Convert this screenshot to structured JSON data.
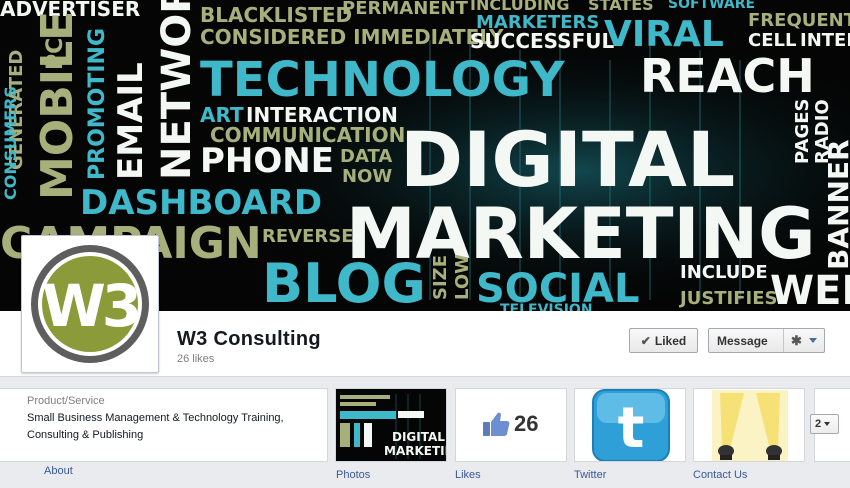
{
  "cover": {
    "words": [
      "ADVERTISER",
      "BLACKLISTED",
      "PERMANENT",
      "INCLUDING",
      "STATES",
      "SOFTWARE",
      "MARKETERS",
      "VIRAL",
      "FREQUENT",
      "CONSIDERED IMMEDIATELY",
      "SUCCESSFUL",
      "CELL",
      "INTER",
      "MOBILE",
      "PC",
      "GENERATED",
      "PROMOTING",
      "EMAIL",
      "NETWORK",
      "TECHNOLOGY",
      "REACH",
      "ART",
      "INTERACTION",
      "COMMUNICATION",
      "PHONE",
      "DATA",
      "NOW",
      "DIGITAL",
      "MARKETING",
      "PAGES",
      "RADIO",
      "BANNER",
      "DASHBOARD",
      "REVERSE",
      "BLOG",
      "SIZE",
      "LOW",
      "SOCIAL",
      "INCLUDE",
      "JUSTIFIES",
      "WEB",
      "TELEVISION",
      "CAMPAIGN",
      "CONSUMERS"
    ],
    "colors": {
      "teal": "#3fb8c9",
      "white": "#f4f8f4",
      "olive": "#a7b07a"
    }
  },
  "profile": {
    "logo_text": "W3",
    "logo_colors": {
      "ring": "#5e5e5e",
      "fill": "#8b9b3a"
    }
  },
  "header": {
    "page_name": "W3 Consulting",
    "likes": "26 likes",
    "liked_button": "Liked",
    "message_button": "Message"
  },
  "info": {
    "category": "Product/Service",
    "description": "Small Business Management & Technology Training, Consulting & Publishing",
    "about_link": "About"
  },
  "apps": {
    "photos_label": "Photos",
    "likes_label": "Likes",
    "likes_number": "26",
    "twitter_label": "Twitter",
    "contact_label": "Contact Us",
    "more_count": "2"
  },
  "colors": {
    "link": "#3b5998",
    "name": "#141823"
  }
}
